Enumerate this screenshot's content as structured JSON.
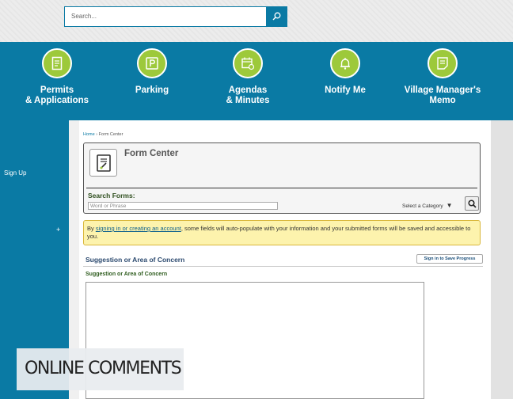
{
  "search": {
    "placeholder": "Search..."
  },
  "nav": [
    {
      "label_line1": "Permits",
      "label_line2": "& Applications",
      "icon": "document-icon"
    },
    {
      "label_line1": "Parking",
      "label_line2": "",
      "icon": "parking-icon"
    },
    {
      "label_line1": "Agendas",
      "label_line2": "& Minutes",
      "icon": "calendar-icon"
    },
    {
      "label_line1": "Notify Me",
      "label_line2": "",
      "icon": "bell-icon"
    },
    {
      "label_line1": "Village Manager's",
      "label_line2": "Memo",
      "icon": "memo-icon"
    }
  ],
  "sidebar": {
    "signup_label": "Sign Up",
    "expand_label": "+"
  },
  "breadcrumb": {
    "home": "Home",
    "separator": " › ",
    "current": "Form Center"
  },
  "form_center": {
    "title": "Form Center",
    "search_label": "Search Forms:",
    "search_placeholder": "Word or Phrase",
    "category_label": "Select a Category"
  },
  "notice": {
    "prefix": "By ",
    "link": "signing in or creating an account",
    "suffix": ", some fields will auto-populate with your information and your submitted forms will be saved and accessible to you."
  },
  "form": {
    "section_title": "Suggestion or Area of Concern",
    "save_button": "Sign in to Save Progress",
    "field_label": "Suggestion or Area of Concern"
  },
  "overlay": {
    "caption": "ONLINE COMMENTS"
  },
  "colors": {
    "primary": "#0a7aa4",
    "nav_icon": "#9dc93b",
    "notice_bg": "#fdf3ad"
  }
}
